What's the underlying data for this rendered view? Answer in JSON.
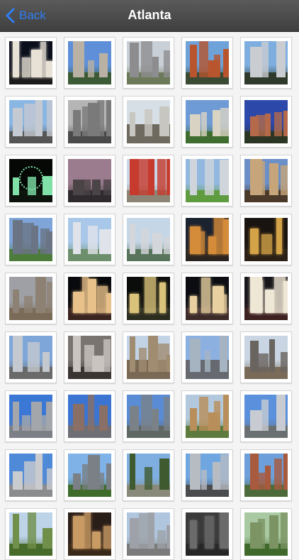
{
  "navbar": {
    "back_label": "Back",
    "title": "Atlanta"
  },
  "gallery": {
    "photos": [
      {
        "sky": "#0b0f1c",
        "ground": "#1a1a1a",
        "bld": "#e8e2d6",
        "kind": "night"
      },
      {
        "sky": "#5f8fd8",
        "ground": "#3c5a35",
        "bld": "#b9b2a4",
        "kind": "day"
      },
      {
        "sky": "#c9cfd6",
        "ground": "#6d7a5a",
        "bld": "#8d8d90",
        "kind": "day"
      },
      {
        "sky": "#6fa2d8",
        "ground": "#3b4a33",
        "bld": "#b8552e",
        "kind": "day"
      },
      {
        "sky": "#7eaedf",
        "ground": "#2f3a2c",
        "bld": "#c9ccd0",
        "kind": "day"
      },
      {
        "sky": "#8ab6e4",
        "ground": "#555555",
        "bld": "#c4c9d2",
        "kind": "day"
      },
      {
        "sky": "#b5b5b5",
        "ground": "#4a4a4a",
        "bld": "#7a7a7a",
        "kind": "interior"
      },
      {
        "sky": "#d7dfe6",
        "ground": "#6e6a5f",
        "bld": "#c8c6c0",
        "kind": "crowd"
      },
      {
        "sky": "#6e9ad5",
        "ground": "#3f6d2f",
        "bld": "#d9d3c4",
        "kind": "day"
      },
      {
        "sky": "#2c48a8",
        "ground": "#2b3523",
        "bld": "#b46a4a",
        "kind": "day"
      },
      {
        "sky": "#050805",
        "ground": "#0d140d",
        "bld": "#7fe0a8",
        "kind": "firework"
      },
      {
        "sky": "#9b7b8e",
        "ground": "#2f2a2d",
        "bld": "#4a4446",
        "kind": "dusk"
      },
      {
        "sky": "#c9d7e6",
        "ground": "#8c8576",
        "bld": "#c63b2d",
        "kind": "day"
      },
      {
        "sky": "#93b8e0",
        "ground": "#5f9b3f",
        "bld": "#cfd5db",
        "kind": "day"
      },
      {
        "sky": "#6b8fc7",
        "ground": "#4b3a2a",
        "bld": "#c7a57a",
        "kind": "day"
      },
      {
        "sky": "#7ea4d8",
        "ground": "#4d7b3c",
        "bld": "#6a7484",
        "kind": "day"
      },
      {
        "sky": "#a9c7e8",
        "ground": "#6d8f6b",
        "bld": "#e0e4ea",
        "kind": "day"
      },
      {
        "sky": "#c5d6e6",
        "ground": "#58745a",
        "bld": "#d3d6da",
        "kind": "day"
      },
      {
        "sky": "#1b2230",
        "ground": "#2a2420",
        "bld": "#d58c3a",
        "kind": "night"
      },
      {
        "sky": "#1a1410",
        "ground": "#2a2016",
        "bld": "#d4a347",
        "kind": "night"
      },
      {
        "sky": "#9ea0a6",
        "ground": "#7a6a58",
        "bld": "#8d8173",
        "kind": "day"
      },
      {
        "sky": "#08090c",
        "ground": "#3a2420",
        "bld": "#e7c08a",
        "kind": "night"
      },
      {
        "sky": "#0b0d0b",
        "ground": "#2b2c20",
        "bld": "#d9c27a",
        "kind": "night"
      },
      {
        "sky": "#0b0d12",
        "ground": "#3d2b2a",
        "bld": "#e8d0a0",
        "kind": "night"
      },
      {
        "sky": "#18161a",
        "ground": "#3d2020",
        "bld": "#efe7d5",
        "kind": "night"
      },
      {
        "sky": "#7fa6d8",
        "ground": "#6a6a6a",
        "bld": "#c4c9d0",
        "kind": "day"
      },
      {
        "sky": "#7a7470",
        "ground": "#3a3432",
        "bld": "#c9c4c0",
        "kind": "interior"
      },
      {
        "sky": "#c3d3e6",
        "ground": "#7a6a55",
        "bld": "#a08c70",
        "kind": "crowd"
      },
      {
        "sky": "#8cb0e0",
        "ground": "#666a70",
        "bld": "#a6b4c2",
        "kind": "crowd"
      },
      {
        "sky": "#c9d5e2",
        "ground": "#7a6a58",
        "bld": "#6a6460",
        "kind": "day"
      },
      {
        "sky": "#3b78d6",
        "ground": "#7c7f86",
        "bld": "#a3a7ac",
        "kind": "day"
      },
      {
        "sky": "#3c74d1",
        "ground": "#6d6f74",
        "bld": "#8a6f66",
        "kind": "day"
      },
      {
        "sky": "#5a8cd6",
        "ground": "#5f6763",
        "bld": "#7a8288",
        "kind": "day"
      },
      {
        "sky": "#b2c8dc",
        "ground": "#5d7a3f",
        "bld": "#b88e5a",
        "kind": "day"
      },
      {
        "sky": "#5b91dc",
        "ground": "#6a7071",
        "bld": "#c8ccd2",
        "kind": "day"
      },
      {
        "sky": "#4f8ad8",
        "ground": "#8a8c8e",
        "bld": "#c9cbcf",
        "kind": "day"
      },
      {
        "sky": "#7fb2e6",
        "ground": "#3f6b2b",
        "bld": "#7b7f86",
        "kind": "day"
      },
      {
        "sky": "#7eafe0",
        "ground": "#8a8a7a",
        "bld": "#3f5a2f",
        "kind": "day"
      },
      {
        "sky": "#6fa6e0",
        "ground": "#4a4c4e",
        "bld": "#b7bcc3",
        "kind": "day"
      },
      {
        "sky": "#6d9fdb",
        "ground": "#4d6b3a",
        "bld": "#a85a3e",
        "kind": "day"
      },
      {
        "sky": "#bcd3e8",
        "ground": "#466b2a",
        "bld": "#6f8f4a",
        "kind": "day"
      },
      {
        "sky": "#2a1e18",
        "ground": "#3a2818",
        "bld": "#c89a64",
        "kind": "night"
      },
      {
        "sky": "#b0c6de",
        "ground": "#7b7b7b",
        "bld": "#9ea2a8",
        "kind": "day"
      },
      {
        "sky": "#3a3a3a",
        "ground": "#262626",
        "bld": "#6b6b6b",
        "kind": "night"
      },
      {
        "sky": "#a9c9a2",
        "ground": "#3f6a2c",
        "bld": "#7c9464",
        "kind": "day"
      }
    ]
  }
}
